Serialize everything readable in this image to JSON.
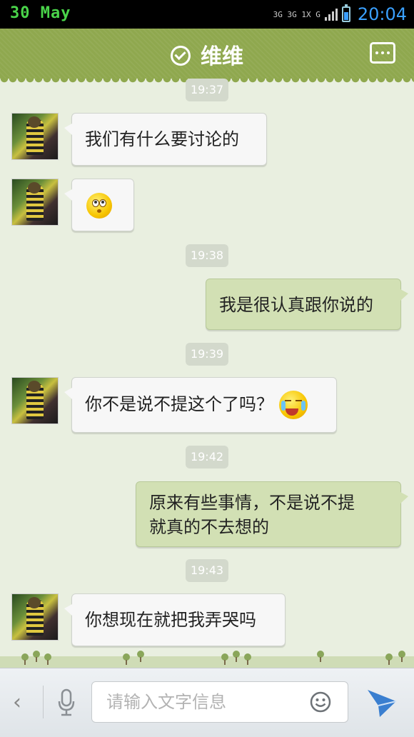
{
  "status_bar": {
    "date": "30 May",
    "network": "3G 3G 1X G",
    "time": "20:04"
  },
  "header": {
    "title": "维维"
  },
  "messages": [
    {
      "type": "time",
      "text": "19:37"
    },
    {
      "type": "incoming",
      "text": "我们有什么要讨论的"
    },
    {
      "type": "incoming",
      "emoji": "confused-face-emoji"
    },
    {
      "type": "time",
      "text": "19:38"
    },
    {
      "type": "outgoing",
      "text": "我是很认真跟你说的"
    },
    {
      "type": "time",
      "text": "19:39"
    },
    {
      "type": "incoming",
      "text": "你不是说不提这个了吗？",
      "emoji": "crying-laughing-emoji"
    },
    {
      "type": "time",
      "text": "19:42"
    },
    {
      "type": "outgoing",
      "text_line1": "原来有些事情，不是说不提",
      "text_line2": "就真的不去想的"
    },
    {
      "type": "time",
      "text": "19:43"
    },
    {
      "type": "incoming",
      "text": "你想现在就把我弄哭吗"
    }
  ],
  "input_bar": {
    "placeholder": "请输入文字信息",
    "back_icon": "chevron-left-icon",
    "mic_icon": "microphone-icon",
    "emoji_icon": "smiley-icon",
    "send_icon": "send-icon"
  },
  "colors": {
    "header_green": "#8fa84e",
    "chat_bg": "#e9efe0",
    "outgoing_bubble": "#d2e0b4",
    "incoming_bubble": "#f7f7f7",
    "send_blue": "#3a7fd0"
  }
}
